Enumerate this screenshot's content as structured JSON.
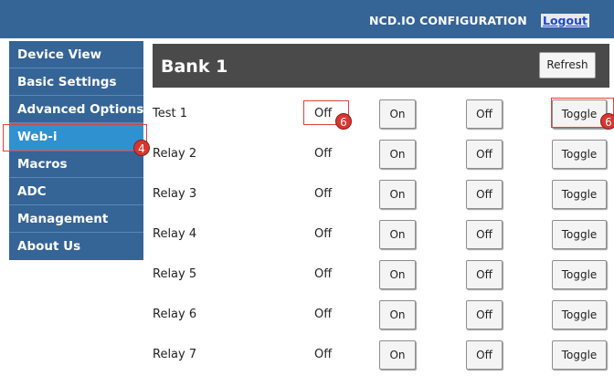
{
  "header": {
    "title": "NCD.IO CONFIGURATION",
    "logout_label": "Logout"
  },
  "sidebar": {
    "items": [
      {
        "label": "Device View"
      },
      {
        "label": "Basic Settings"
      },
      {
        "label": "Advanced Options"
      },
      {
        "label": "Web-i"
      },
      {
        "label": "Macros"
      },
      {
        "label": "ADC"
      },
      {
        "label": "Management"
      },
      {
        "label": "About Us"
      }
    ]
  },
  "bank": {
    "title": "Bank 1",
    "refresh_label": "Refresh"
  },
  "buttons": {
    "on_label": "On",
    "off_label": "Off",
    "toggle_label": "Toggle"
  },
  "relays": [
    {
      "name": "Test 1",
      "state": "Off"
    },
    {
      "name": "Relay 2",
      "state": "Off"
    },
    {
      "name": "Relay 3",
      "state": "Off"
    },
    {
      "name": "Relay 4",
      "state": "Off"
    },
    {
      "name": "Relay 5",
      "state": "Off"
    },
    {
      "name": "Relay 6",
      "state": "Off"
    },
    {
      "name": "Relay 7",
      "state": "Off"
    }
  ],
  "annotations": {
    "web_i_marker": "4",
    "state_marker": "6",
    "toggle_marker": "6"
  }
}
